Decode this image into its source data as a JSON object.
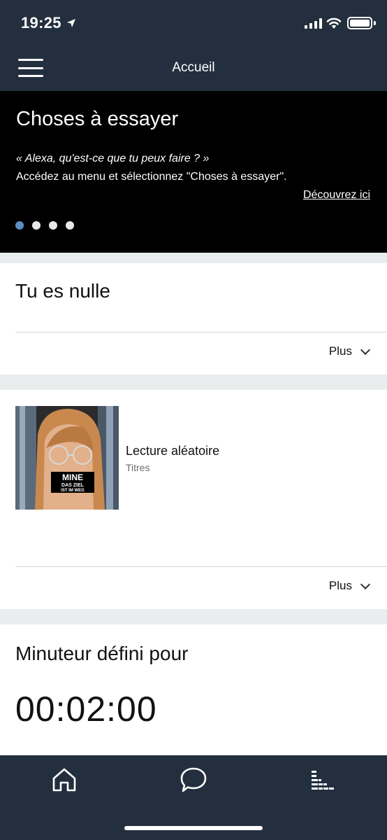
{
  "status_bar": {
    "time": "19:25"
  },
  "header": {
    "title": "Accueil"
  },
  "hero": {
    "title": "Choses à essayer",
    "quote": "« Alexa, qu'est-ce que tu peux faire ? »",
    "description": "Accédez au menu et sélectionnez \"Choses à essayer\".",
    "link": "Découvrez ici",
    "page_count": 4,
    "active_page": 1
  },
  "cards": {
    "card1": {
      "title": "Tu es nulle",
      "more_label": "Plus"
    },
    "card2": {
      "track_title": "Lecture aléatoire",
      "track_subtitle": "Titres",
      "album_art_text": [
        "MINE",
        "DAS ZIEL",
        "IST IM WEG"
      ],
      "more_label": "Plus"
    },
    "card3": {
      "title": "Minuteur défini pour",
      "timer_value": "00:02:00"
    }
  },
  "bottom_nav": {
    "items": [
      "home-icon",
      "chat-icon",
      "music-icon"
    ]
  },
  "colors": {
    "bar_background": "#232f3e",
    "hero_background": "#000000",
    "active_dot": "#5b8dc2",
    "feed_background": "#eaeded"
  }
}
